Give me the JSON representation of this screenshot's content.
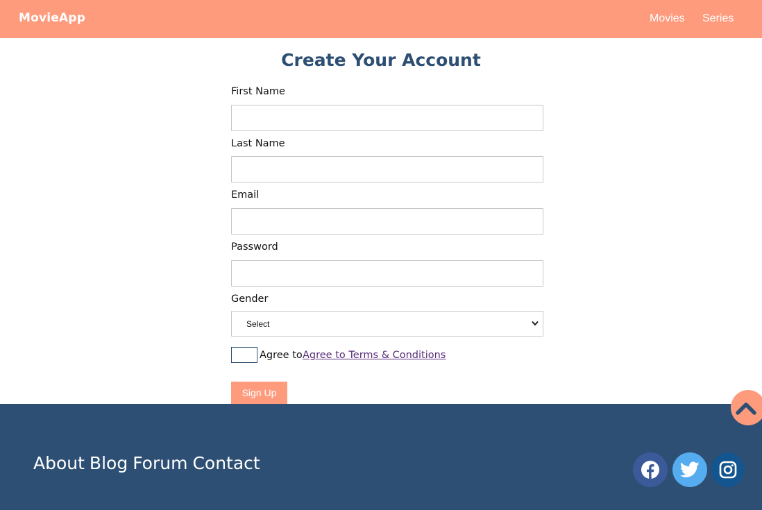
{
  "navbar": {
    "brand": "MovieApp",
    "links": [
      {
        "label": "Movies"
      },
      {
        "label": "Series"
      }
    ],
    "color": "#fe9b7d"
  },
  "form": {
    "title": "Create Your Account",
    "fields": [
      {
        "label": "First Name",
        "value": "",
        "placeholder": ""
      },
      {
        "label": "Last Name",
        "value": "",
        "placeholder": ""
      },
      {
        "label": "Email",
        "value": "",
        "placeholder": ""
      },
      {
        "label": "Password",
        "value": "",
        "placeholder": ""
      }
    ],
    "gender": {
      "label": "Gender",
      "selected": "Select"
    },
    "agree": {
      "text": "Agree to",
      "link": "Agree to Terms & Conditions",
      "checked": false
    },
    "submit_label": "Sign Up"
  },
  "footer": {
    "links": [
      {
        "label": "About"
      },
      {
        "label": "Blog"
      },
      {
        "label": "Forum"
      },
      {
        "label": "Contact"
      }
    ],
    "social": [
      {
        "icon": "facebook-icon",
        "color": "#3b5a9a"
      },
      {
        "icon": "twitter-icon",
        "color": "#55acee"
      },
      {
        "icon": "instagram-icon",
        "color": "#13568f"
      }
    ],
    "color": "#2d4f73"
  },
  "scroll_top": {
    "icon": "chevron-up-icon",
    "color": "#fe9b7d"
  },
  "colors": {
    "accent": "#fe9b7d",
    "primary": "#2d4f73"
  }
}
